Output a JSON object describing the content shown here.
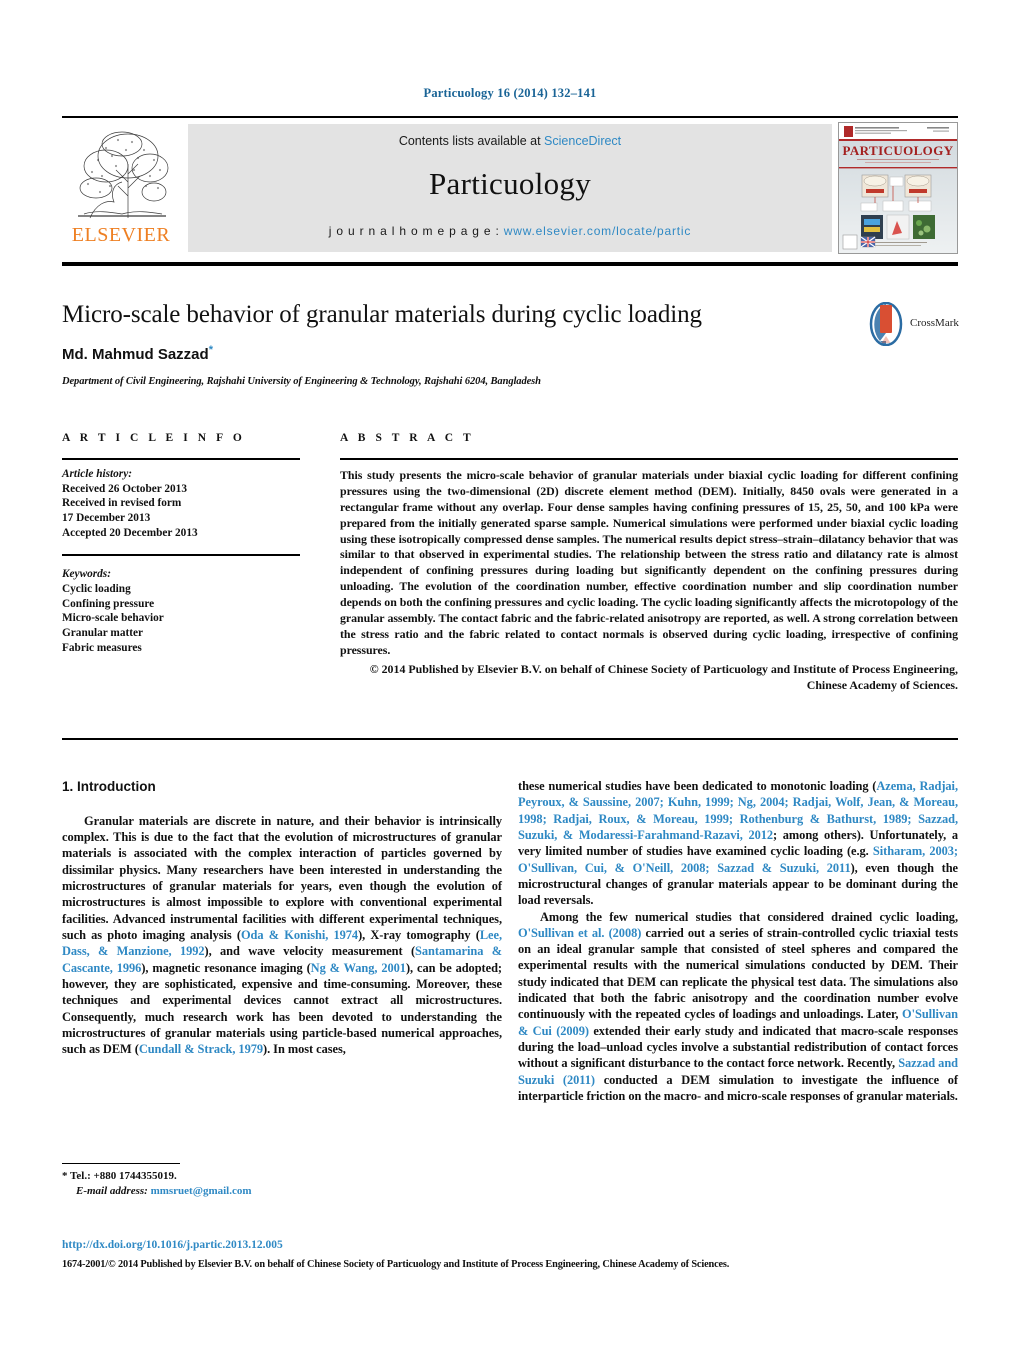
{
  "running_head": "Particuology 16 (2014) 132–141",
  "masthead": {
    "contents_prefix": "Contents lists available at ",
    "sciencedirect": "ScienceDirect",
    "journal_name": "Particuology",
    "homepage_prefix": "j o u r n a l   h o m e p a g e :   ",
    "homepage_url": "www.elsevier.com/locate/partic",
    "publisher_logo_text": "ELSEVIER",
    "cover_title": "PARTICUOLOGY"
  },
  "article": {
    "title": "Micro-scale behavior of granular materials during cyclic loading",
    "author": "Md. Mahmud Sazzad",
    "author_marker": "*",
    "affiliation": "Department of Civil Engineering, Rajshahi University of Engineering & Technology, Rajshahi 6204, Bangladesh",
    "crossmark_label": "CrossMark"
  },
  "article_info": {
    "heading": "A R T I C L E    I N F O",
    "history_label": "Article history:",
    "history_lines": [
      "Received 26 October 2013",
      "Received in revised form",
      "17 December 2013",
      "Accepted 20 December 2013"
    ],
    "keywords_label": "Keywords:",
    "keywords": [
      "Cyclic loading",
      "Confining pressure",
      "Micro-scale behavior",
      "Granular matter",
      "Fabric measures"
    ]
  },
  "abstract": {
    "heading": "A B S T R A C T",
    "text": "This study presents the micro-scale behavior of granular materials under biaxial cyclic loading for different confining pressures using the two-dimensional (2D) discrete element method (DEM). Initially, 8450 ovals were generated in a rectangular frame without any overlap. Four dense samples having confining pressures of 15, 25, 50, and 100 kPa were prepared from the initially generated sparse sample. Numerical simulations were performed under biaxial cyclic loading using these isotropically compressed dense samples. The numerical results depict stress–strain–dilatancy behavior that was similar to that observed in experimental studies. The relationship between the stress ratio and dilatancy rate is almost independent of confining pressures during loading but significantly dependent on the confining pressures during unloading. The evolution of the coordination number, effective coordination number and slip coordination number depends on both the confining pressures and cyclic loading. The cyclic loading significantly affects the microtopology of the granular assembly. The contact fabric and the fabric-related anisotropy are reported, as well. A strong correlation between the stress ratio and the fabric related to contact normals is observed during cyclic loading, irrespective of confining pressures.",
    "copyright": "© 2014 Published by Elsevier B.V. on behalf of Chinese Society of Particuology and Institute of Process Engineering, Chinese Academy of Sciences."
  },
  "body": {
    "section_heading": "1.  Introduction",
    "left_paragraph_1_a": "Granular materials are discrete in nature, and their behavior is intrinsically complex. This is due to the fact that the evolution of microstructures of granular materials is associated with the complex interaction of particles governed by dissimilar physics. Many researchers have been interested in understanding the microstructures of granular materials for years, even though the evolution of microstructures is almost impossible to explore with conventional experimental facilities. Advanced instrumental facilities with different experimental techniques, such as photo imaging analysis (",
    "ref_oda": "Oda & Konishi, 1974",
    "left_paragraph_1_b": "), X-ray tomography (",
    "ref_lee": "Lee, Dass, & Manzione, 1992",
    "left_paragraph_1_c": "), and wave velocity measurement (",
    "ref_santamarina": "Santamarina & Cascante, 1996",
    "left_paragraph_1_d": "), magnetic resonance imaging (",
    "ref_ng": "Ng & Wang, 2001",
    "left_paragraph_1_e": "), can be adopted; however, they are sophisticated, expensive and time-consuming. Moreover, these techniques and experimental devices cannot extract all microstructures. Consequently, much research work has been devoted to understanding the microstructures of granular materials using particle-based numerical approaches, such as DEM (",
    "ref_cundall": "Cundall & Strack, 1979",
    "left_paragraph_1_f": "). In most cases,",
    "right_paragraph_1_a": "these numerical studies have been dedicated to monotonic loading (",
    "ref_group_1": "Azema, Radjai, Peyroux, & Saussine, 2007; Kuhn, 1999; Ng, 2004; Radjai, Wolf, Jean, & Moreau, 1998; Radjai, Roux, & Moreau, 1999; Rothenburg & Bathurst, 1989; Sazzad, Suzuki, & Modaressi-Farahmand-Razavi, 2012",
    "right_paragraph_1_b": "; among others). Unfortunately, a very limited number of studies have examined cyclic loading (e.g. ",
    "ref_group_2": "Sitharam, 2003; O'Sullivan, Cui, & O'Neill, 2008; Sazzad & Suzuki, 2011",
    "right_paragraph_1_c": "), even though the microstructural changes of granular materials appear to be dominant during the load reversals.",
    "right_paragraph_2_a": "Among the few numerical studies that considered drained cyclic loading, ",
    "ref_osullivan_2008": "O'Sullivan et al. (2008)",
    "right_paragraph_2_b": " carried out a series of strain-controlled cyclic triaxial tests on an ideal granular sample that consisted of steel spheres and compared the experimental results with the numerical simulations conducted by DEM. Their study indicated that DEM can replicate the physical test data. The simulations also indicated that both the fabric anisotropy and the coordination number evolve continuously with the repeated cycles of loadings and unloadings. Later, ",
    "ref_osullivan_2009": "O'Sullivan & Cui (2009)",
    "right_paragraph_2_c": " extended their early study and indicated that macro-scale responses during the load–unload cycles involve a substantial redistribution of contact forces without a significant disturbance to the contact force network. Recently, ",
    "ref_sazzad_2011": "Sazzad and Suzuki (2011)",
    "right_paragraph_2_d": " conducted a DEM simulation to investigate the influence of interparticle friction on the macro- and micro-scale responses of granular materials."
  },
  "footnote": {
    "marker_tel": "* Tel.: +880 1744355019.",
    "email_label": "E-mail address:",
    "email": "mmsruet@gmail.com"
  },
  "footer": {
    "doi": "http://dx.doi.org/10.1016/j.partic.2013.12.005",
    "legal": "1674-2001/© 2014 Published by Elsevier B.V. on behalf of Chinese Society of Particuology and Institute of Process Engineering, Chinese Academy of Sciences."
  },
  "colors": {
    "link": "#2f89c4",
    "runhead": "#1a6496",
    "elsevier_orange": "#ee7f22",
    "panel_gray": "#e3e3e3"
  }
}
